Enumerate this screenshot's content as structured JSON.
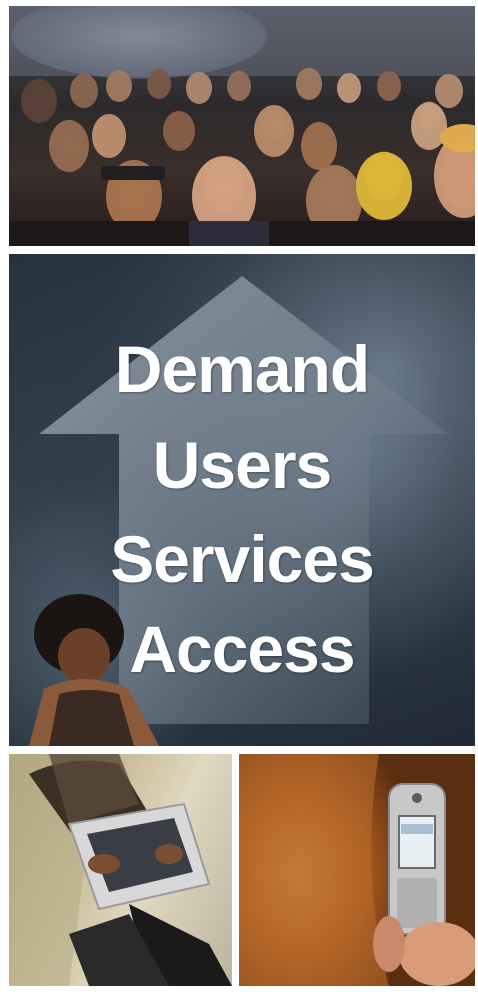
{
  "hero": {
    "lines": [
      "Demand",
      "Users",
      "Services",
      "Access"
    ]
  },
  "colors": {
    "hero_background": "#2e3b48",
    "hero_text": "#ffffff",
    "arrow": "#8a96a2"
  },
  "images": {
    "top": "crowd-photo",
    "middle_left": "woman-photo",
    "bottom_left": "laptop-photo",
    "bottom_right": "mobile-phone-photo"
  }
}
